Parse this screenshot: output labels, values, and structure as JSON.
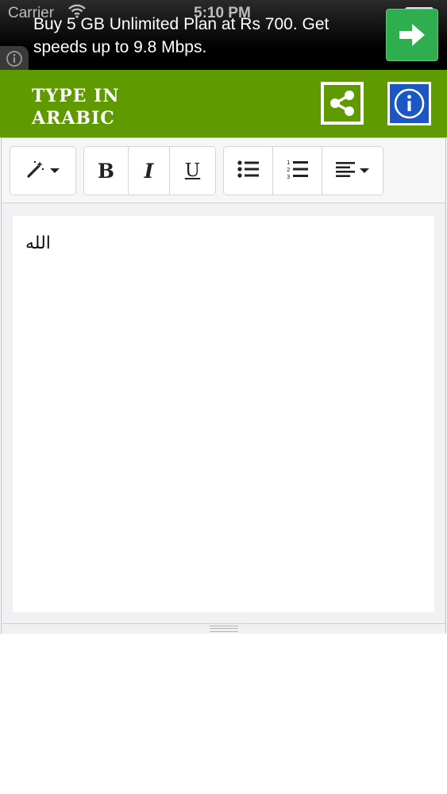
{
  "status_bar": {
    "carrier": "Carrier",
    "time": "5:10 PM"
  },
  "ad": {
    "text": "Buy 5 GB Unlimited Plan at Rs 700. Get speeds up to 9.8 Mbps.",
    "go_icon": "arrow-right-icon",
    "info_icon": "info-circle-icon"
  },
  "header": {
    "title_line1": "TYPE IN",
    "title_line2": "ARABIC",
    "share_icon": "share-icon",
    "info_icon": "info-icon",
    "color": "#5e9a00"
  },
  "toolbar": {
    "style_icon": "magic-wand-icon",
    "bold_label": "B",
    "italic_label": "I",
    "underline_label": "U",
    "bullet_list_icon": "bullet-list-icon",
    "numbered_list_icon": "numbered-list-icon",
    "align_icon": "align-left-icon"
  },
  "editor": {
    "content": "الله"
  }
}
